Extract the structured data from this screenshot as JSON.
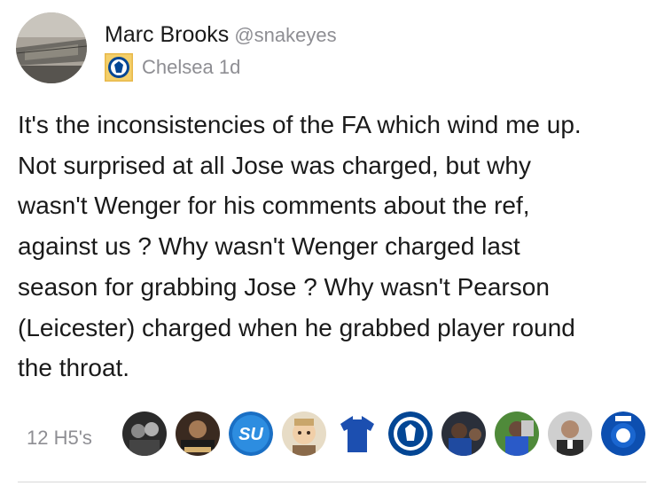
{
  "post": {
    "author_name": "Marc Brooks",
    "author_handle": "@snakeyes",
    "meta": "Chelsea 1d",
    "badge_icon": "chelsea-badge-icon",
    "lines": [
      "It's the inconsistencies of the FA which wind me up.",
      "Not surprised at all Jose was charged, but why",
      "wasn't Wenger for his comments about the ref,",
      "against us ? Why wasn't Wenger charged last",
      "season for grabbing Jose ? Why wasn't Pearson",
      "(Leicester) charged when he grabbed player round",
      "the throat."
    ]
  },
  "reactions": {
    "count_label": "12 H5's",
    "avatars": [
      "user-avatar-1",
      "user-avatar-2",
      "su-logo-avatar",
      "user-avatar-4",
      "chelsea-shirt-avatar",
      "chelsea-crest-avatar",
      "user-avatar-7",
      "user-avatar-8",
      "user-avatar-9",
      "crest-avatar-10"
    ]
  },
  "colors": {
    "text": "#1a1a1a",
    "muted": "#8e8e93",
    "chelsea_blue": "#034694"
  }
}
